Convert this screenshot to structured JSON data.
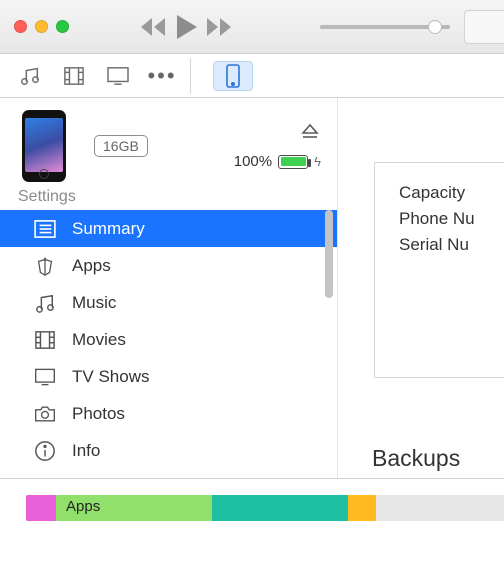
{
  "device": {
    "storage_capacity": "16GB",
    "battery_percent": "100%"
  },
  "sidebar": {
    "heading": "Settings",
    "items": [
      {
        "label": "Summary"
      },
      {
        "label": "Apps"
      },
      {
        "label": "Music"
      },
      {
        "label": "Movies"
      },
      {
        "label": "TV Shows"
      },
      {
        "label": "Photos"
      },
      {
        "label": "Info"
      }
    ]
  },
  "detail": {
    "row1": "Capacity",
    "row2": "Phone Nu",
    "row3": "Serial Nu",
    "backups_heading": "Backups"
  },
  "storage": {
    "segment_label": "Apps"
  }
}
